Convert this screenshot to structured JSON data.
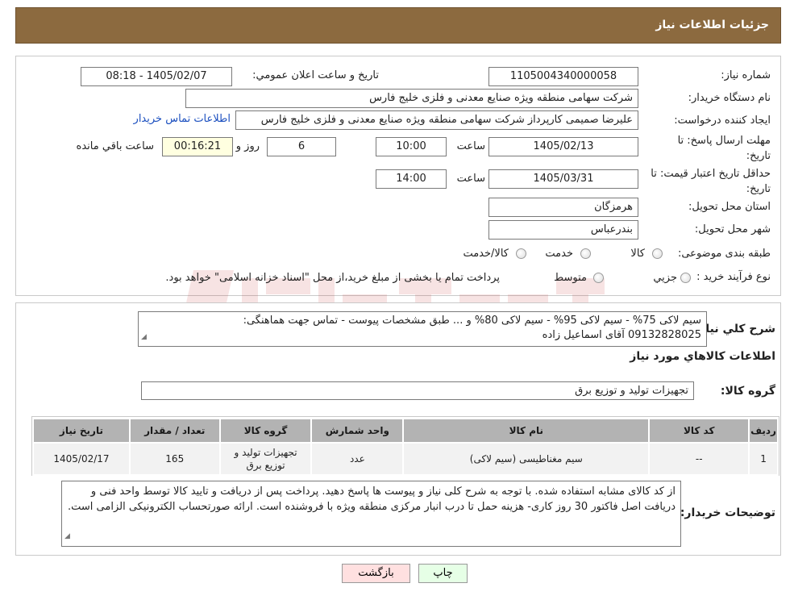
{
  "header": {
    "title": "جزئیات اطلاعات نیاز"
  },
  "form": {
    "need_number_label": "شماره نیاز:",
    "need_number": "1105004340000058",
    "announce_label": "تاریخ و ساعت اعلان عمومي:",
    "announce_value": "1405/02/07 - 08:18",
    "buyer_org_label": "نام دستگاه خريدار:",
    "buyer_org": "شرکت سهامی منطقه ویژه صنایع معدنی و فلزی خلیج فارس",
    "creator_label": "ايجاد كننده درخواست:",
    "creator": "علیرضا صمیمی کارپرداز شرکت سهامی منطقه ویژه صنایع معدنی و فلزی خلیج فارس",
    "buyer_contact_link": "اطلاعات تماس خریدار",
    "deadline_label_1": "مهلت ارسال پاسخ: تا",
    "deadline_label_2": "تاريخ:",
    "deadline_date": "1405/02/13",
    "time_word": "ساعت",
    "deadline_time": "10:00",
    "days_value": "6",
    "days_word": "روز و",
    "remaining_value": "00:16:21",
    "remaining_word": "ساعت باقي مانده",
    "validity_label_1": "حداقل تاريخ اعتبار قيمت: تا",
    "validity_label_2": "تاريخ:",
    "validity_date": "1405/03/31",
    "validity_time": "14:00",
    "province_label": "استان محل تحويل:",
    "province": "هرمزگان",
    "city_label": "شهر محل تحويل:",
    "city": "بندرعباس",
    "category_label": "طبقه بندی موضوعی:",
    "category_options": [
      "کالا",
      "خدمت",
      "کالا/خدمت"
    ],
    "process_label": "نوع فرآيند خريد :",
    "process_options": [
      "جزيي",
      "متوسط"
    ],
    "process_note": "پرداخت تمام یا بخشی از مبلغ خرید،از محل \"اسناد خزانه اسلامی\" خواهد بود."
  },
  "details": {
    "summary_label": "شرح کلي نياز:",
    "summary_line1": "سیم لاکی 75% - سیم لاکی 95% - سیم لاکی 80% و ... طبق مشخصات پیوست - تماس جهت هماهنگی:",
    "summary_line2": "09132828025 آقای اسماعیل زاده",
    "goods_info_title": "اطلاعات کالاهاي مورد نياز",
    "goods_group_label": "گروه کالا:",
    "goods_group": "تجهیزات تولید و توزیع برق",
    "table": {
      "headers": [
        "رديف",
        "کد کالا",
        "نام کالا",
        "واحد شمارش",
        "گروه کالا",
        "تعداد / مقدار",
        "تاريخ نياز"
      ],
      "rows": [
        {
          "row": "1",
          "code": "--",
          "name": "سیم مغناطیسی (سیم لاکی)",
          "unit": "عدد",
          "group": "تجهیزات تولید و توزیع برق",
          "qty": "165",
          "date": "1405/02/17"
        }
      ]
    },
    "buyer_notes_label": "توضيحات خريدار:",
    "buyer_notes": "از کد کالای مشابه استفاده شده. با توجه به شرح کلی نیاز و پیوست ها پاسخ دهید. پرداخت پس از دریافت و تایید کالا توسط واحد فنی و دریافت اصل فاکتور 30 روز کاری- هزینه حمل تا درب انبار مرکزی منطقه ویژه با فروشنده است. ارائه صورتحساب الکترونیکی الزامی است."
  },
  "buttons": {
    "back": "بازگشت",
    "print": "چاپ"
  },
  "colors": {
    "header_bg": "#8c6a3f",
    "table_header_bg": "#b3b3b3",
    "link": "#1b4fbf"
  }
}
